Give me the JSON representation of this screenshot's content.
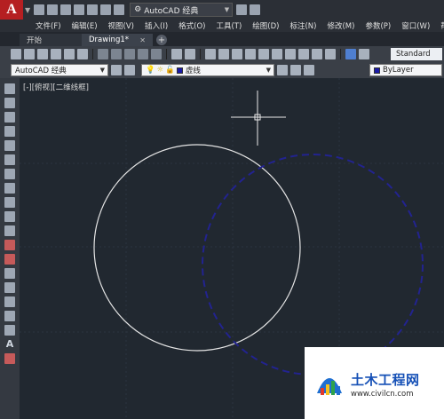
{
  "titlebar": {
    "app_logo": "A",
    "workspace": "AutoCAD 经典"
  },
  "menu": [
    "文件(F)",
    "编辑(E)",
    "视图(V)",
    "插入(I)",
    "格式(O)",
    "工具(T)",
    "绘图(D)",
    "标注(N)",
    "修改(M)",
    "参数(P)",
    "窗口(W)",
    "帮"
  ],
  "tabs": [
    {
      "label": "开始"
    },
    {
      "label": "Drawing1*"
    }
  ],
  "toolbar1": {
    "text_style": "Standard"
  },
  "toolbar2": {
    "workspace": "AutoCAD 经典",
    "layer": "虚线",
    "color": "ByLayer",
    "layer_color": "#1a1aa8"
  },
  "viewport": {
    "label": "[-][俯视][二维线框]"
  },
  "watermark": {
    "title": "土木工程网",
    "url": "www.civilcn.com"
  },
  "colors": {
    "canvas_bg": "#212830",
    "solid_circle": "#e6e6e6",
    "dashed_circle": "#22238f",
    "crosshair": "#eaeaea"
  }
}
